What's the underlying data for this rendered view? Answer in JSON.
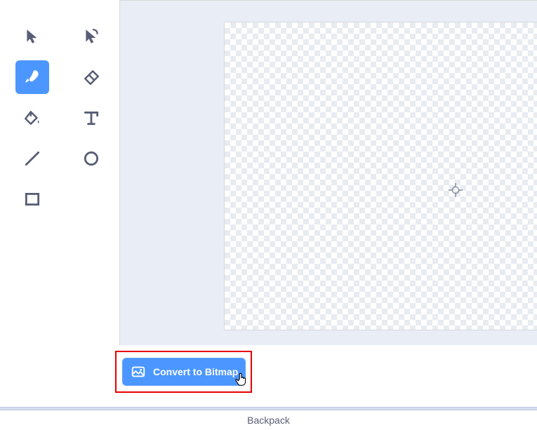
{
  "tools": {
    "select": "select",
    "reshape": "reshape",
    "brush": "brush",
    "eraser": "eraser",
    "fill": "fill",
    "text": "text",
    "line": "line",
    "circle": "circle",
    "rect": "rect"
  },
  "convert": {
    "label": "Convert to Bitmap"
  },
  "footer": {
    "label": "Backpack"
  }
}
